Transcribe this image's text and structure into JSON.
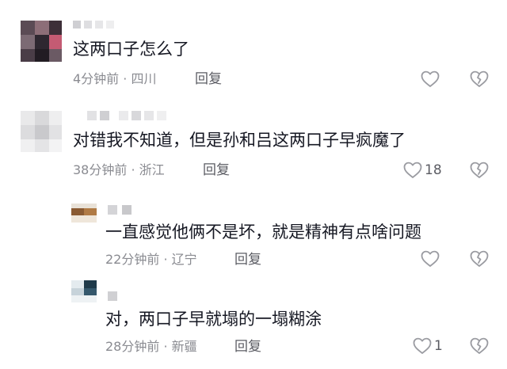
{
  "comments": [
    {
      "text": "这两口子怎么了",
      "time": "4分钟前",
      "location": "四川",
      "reply_label": "回复",
      "likes": ""
    },
    {
      "text": "对错我不知道，但是孙和吕这两口子早疯魔了",
      "time": "38分钟前",
      "location": "浙江",
      "reply_label": "回复",
      "likes": "18"
    }
  ],
  "replies": [
    {
      "text": "一直感觉他俩不是坏，就是精神有点啥问题",
      "time": "22分钟前",
      "location": "辽宁",
      "reply_label": "回复",
      "likes": ""
    },
    {
      "text": "对，两口子早就塌的一塌糊涂",
      "time": "28分钟前",
      "location": "新疆",
      "reply_label": "回复",
      "likes": "1"
    }
  ],
  "meta_separator": "·",
  "icons": {
    "like": "heart-outline-icon",
    "dislike": "broken-heart-icon"
  },
  "colors": {
    "text": "#161823",
    "meta": "#8a8b91",
    "icon": "#9a9ba1"
  }
}
